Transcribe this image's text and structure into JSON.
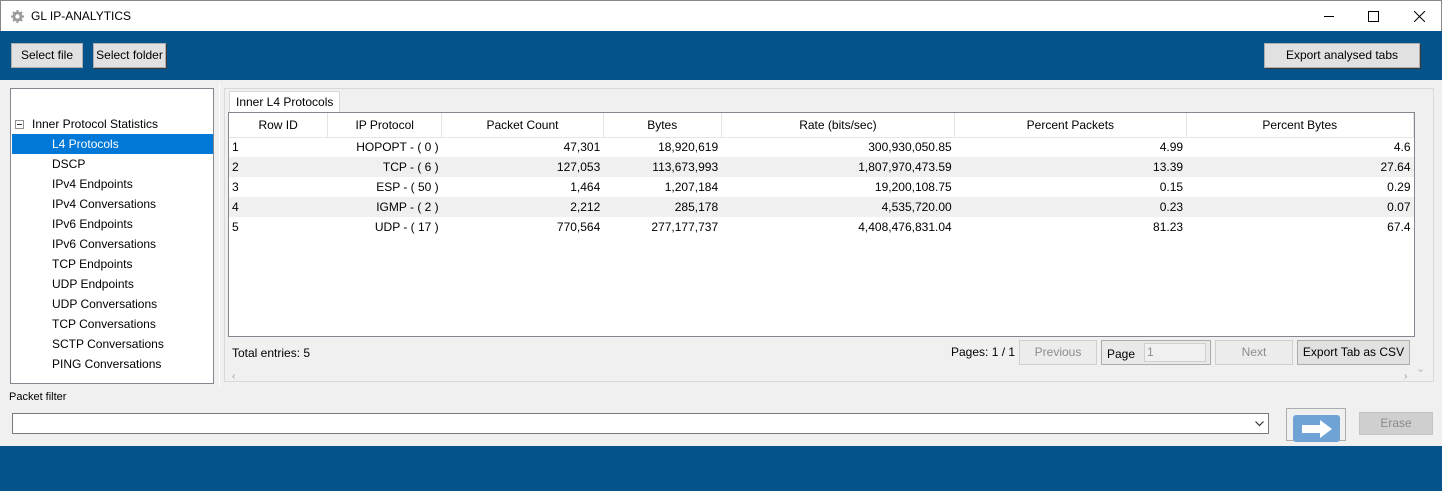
{
  "window": {
    "title": "GL IP-ANALYTICS",
    "icon": "gear-icon"
  },
  "toolbar": {
    "select_file": "Select file",
    "select_folder": "Select folder",
    "export_analysed": "Export analysed tabs"
  },
  "tree": {
    "root_label": "Inner Protocol Statistics",
    "items": [
      {
        "label": "L4 Protocols",
        "selected": true
      },
      {
        "label": "DSCP"
      },
      {
        "label": "IPv4 Endpoints"
      },
      {
        "label": "IPv4 Conversations"
      },
      {
        "label": "IPv6 Endpoints"
      },
      {
        "label": "IPv6 Conversations"
      },
      {
        "label": "TCP Endpoints"
      },
      {
        "label": "UDP Endpoints"
      },
      {
        "label": "UDP Conversations"
      },
      {
        "label": "TCP Conversations"
      },
      {
        "label": "SCTP Conversations"
      },
      {
        "label": "PING Conversations"
      }
    ]
  },
  "tab": {
    "label": "Inner L4 Protocols"
  },
  "table": {
    "columns": [
      "Row ID",
      "IP Protocol",
      "Packet Count",
      "Bytes",
      "Rate (bits/sec)",
      "Percent Packets",
      "Percent Bytes"
    ],
    "rows": [
      [
        "1",
        "HOPOPT - ( 0 )",
        "47,301",
        "18,920,619",
        "300,930,050.85",
        "4.99",
        "4.6"
      ],
      [
        "2",
        "TCP - ( 6 )",
        "127,053",
        "113,673,993",
        "1,807,970,473.59",
        "13.39",
        "27.64"
      ],
      [
        "3",
        "ESP - ( 50 )",
        "1,464",
        "1,207,184",
        "19,200,108.75",
        "0.15",
        "0.29"
      ],
      [
        "4",
        "IGMP - ( 2 )",
        "2,212",
        "285,178",
        "4,535,720.00",
        "0.23",
        "0.07"
      ],
      [
        "5",
        "UDP - ( 17 )",
        "770,564",
        "277,177,737",
        "4,408,476,831.04",
        "81.23",
        "67.4"
      ]
    ]
  },
  "footer": {
    "total_entries": "Total entries: 5",
    "pages": "Pages: 1 / 1",
    "previous": "Previous",
    "page_label": "Page",
    "page_value": "1",
    "next": "Next",
    "export_csv": "Export Tab as CSV"
  },
  "filter": {
    "label": "Packet filter",
    "value": "",
    "erase": "Erase"
  },
  "colors": {
    "brand_blue": "#04538b",
    "selection": "#0078d7"
  }
}
